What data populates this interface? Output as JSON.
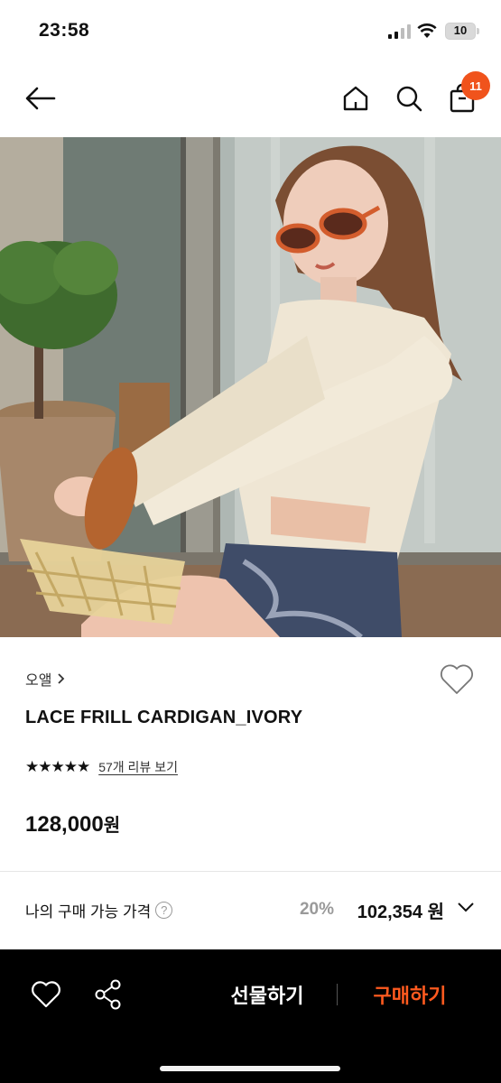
{
  "status_bar": {
    "time": "23:58",
    "battery": "10"
  },
  "nav": {
    "cart_count": "11"
  },
  "product": {
    "brand": "오앨",
    "name": "LACE FRILL CARDIGAN_IVORY",
    "stars": "★★★★★",
    "review_link": "57개 리뷰 보기",
    "price_value": "128,000",
    "price_unit": "원",
    "rating": 5
  },
  "my_price": {
    "label": "나의 구매 가능 가격",
    "help": "?",
    "discount": "20%",
    "price": "102,354 원"
  },
  "bottom_bar": {
    "gift_label": "선물하기",
    "buy_label": "구매하기"
  },
  "colors": {
    "accent": "#ff5a1f",
    "badge": "#f0531c",
    "bottom_bar_bg": "#000000"
  }
}
